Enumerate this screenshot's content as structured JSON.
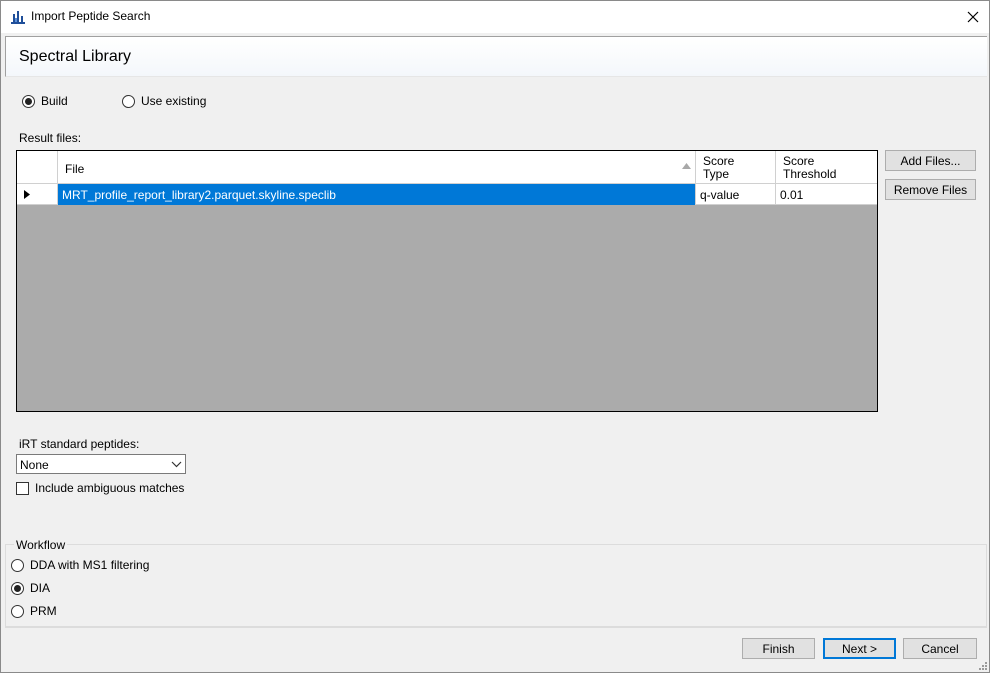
{
  "window": {
    "title": "Import Peptide Search"
  },
  "header": {
    "title": "Spectral Library"
  },
  "library_source": {
    "build_label": "Build",
    "use_existing_label": "Use existing",
    "selected": "Build"
  },
  "result_files": {
    "label": "Result files:",
    "columns": {
      "file": "File",
      "score_type": "Score Type",
      "score_threshold": "Score Threshold"
    },
    "rows": [
      {
        "file": "MRT_profile_report_library2.parquet.skyline.speclib",
        "score_type": "q-value",
        "score_threshold": "0.01"
      }
    ],
    "add_files_label": "Add Files...",
    "remove_files_label": "Remove Files"
  },
  "irt": {
    "label": "iRT standard peptides:",
    "selected": "None"
  },
  "include_ambiguous": {
    "label": "Include ambiguous matches",
    "checked": false
  },
  "workflow": {
    "title": "Workflow",
    "options": [
      "DDA with MS1 filtering",
      "DIA",
      "PRM"
    ],
    "selected": "DIA"
  },
  "footer": {
    "finish_label": "Finish",
    "next_label": "Next >",
    "cancel_label": "Cancel"
  },
  "colors": {
    "selection": "#0078d7",
    "grid_background": "#ababab",
    "window_background": "#f0f0f0"
  }
}
